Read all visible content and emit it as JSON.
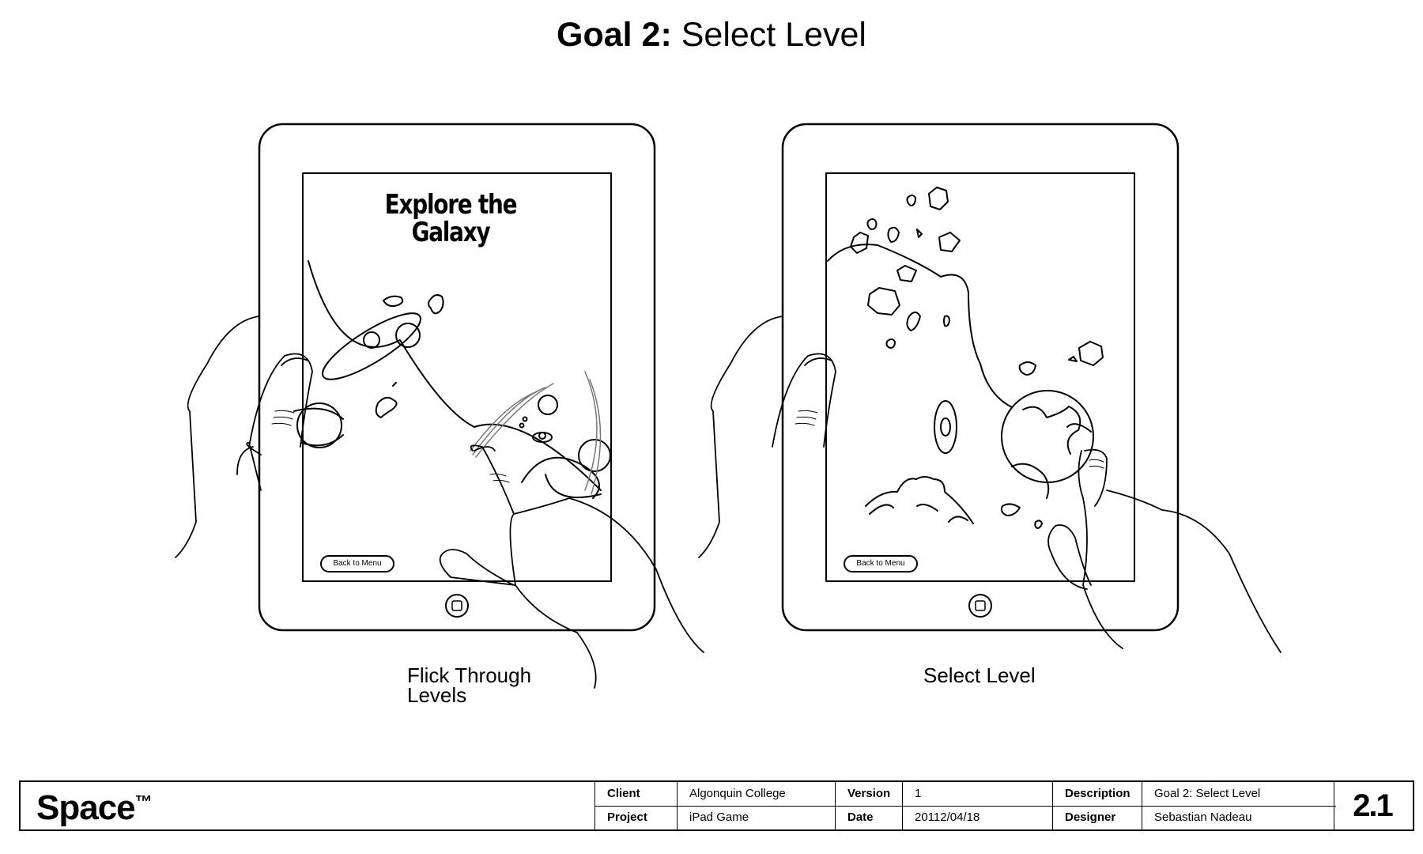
{
  "title": {
    "bold": "Goal 2:",
    "rest": " Select Level"
  },
  "panels": [
    {
      "screen_title": "Explore the Galaxy",
      "back_button": "Back to Menu",
      "caption": "Flick Through Levels"
    },
    {
      "back_button": "Back to Menu",
      "caption": "Select Level"
    }
  ],
  "title_block": {
    "logo": "Space",
    "trademark": "™",
    "client_label": "Client",
    "client": "Algonquin College",
    "project_label": "Project",
    "project": "iPad Game",
    "version_label": "Version",
    "version": "1",
    "date_label": "Date",
    "date": "20112/04/18",
    "description_label": "Description",
    "description": "Goal 2: Select Level",
    "designer_label": "Designer",
    "designer": "Sebastian Nadeau",
    "sheet": "2.1"
  }
}
